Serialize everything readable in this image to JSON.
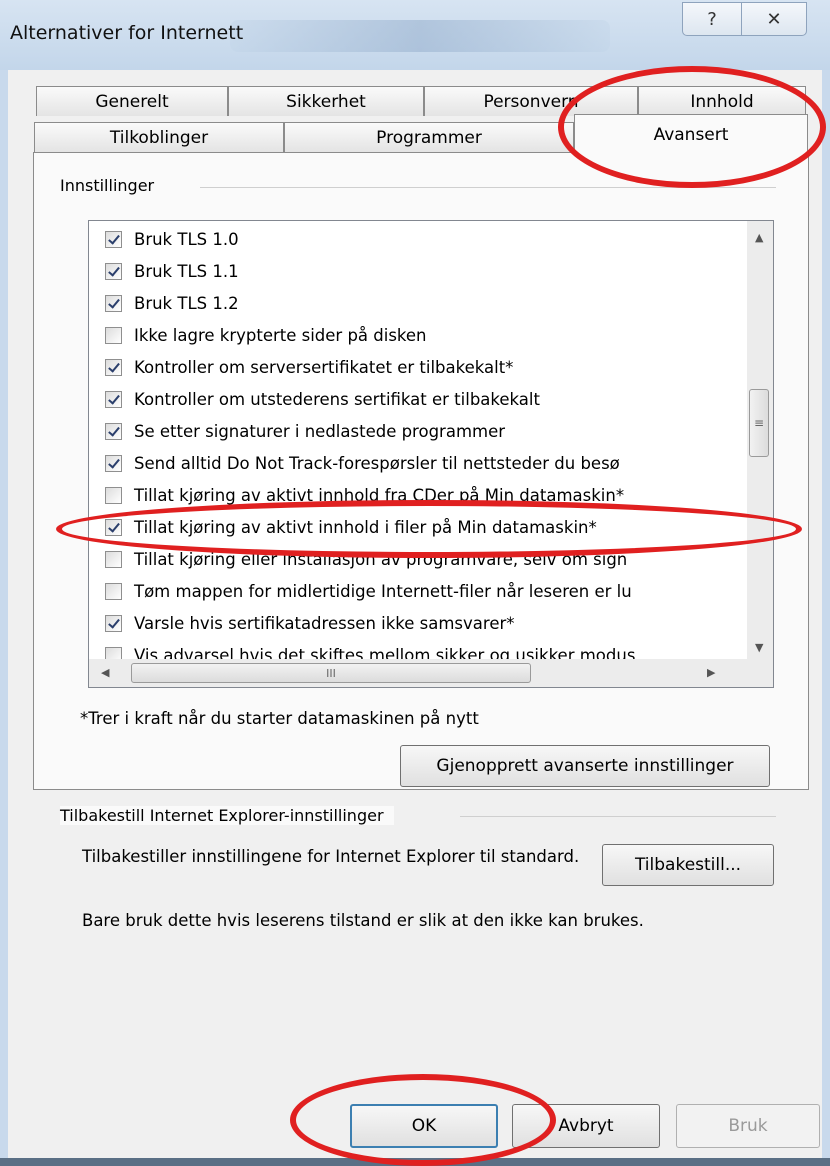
{
  "window": {
    "title": "Alternativer for Internett",
    "help_glyph": "?",
    "close_glyph": "✕"
  },
  "tabs": {
    "row1": [
      "Generelt",
      "Sikkerhet",
      "Personvern",
      "Innhold"
    ],
    "row2": [
      "Tilkoblinger",
      "Programmer",
      "Avansert"
    ],
    "active": "Avansert"
  },
  "settings": {
    "group_label": "Innstillinger",
    "items": [
      {
        "label": "Bruk TLS 1.0",
        "checked": true
      },
      {
        "label": "Bruk TLS 1.1",
        "checked": true
      },
      {
        "label": "Bruk TLS 1.2",
        "checked": true
      },
      {
        "label": "Ikke lagre krypterte sider på disken",
        "checked": false
      },
      {
        "label": "Kontroller om serversertifikatet er tilbakekalt*",
        "checked": true
      },
      {
        "label": "Kontroller om utstederens sertifikat er tilbakekalt",
        "checked": true
      },
      {
        "label": "Se etter signaturer i nedlastede programmer",
        "checked": true
      },
      {
        "label": "Send alltid Do Not Track-forespørsler til nettsteder du besø",
        "checked": true
      },
      {
        "label": "Tillat kjøring av aktivt innhold fra CDer på Min datamaskin*",
        "checked": false
      },
      {
        "label": "Tillat kjøring av aktivt innhold i filer på Min datamaskin*",
        "checked": true
      },
      {
        "label": "Tillat kjøring eller installasjon av programvare, selv om sign",
        "checked": false
      },
      {
        "label": "Tøm mappen for midlertidige Internett-filer når leseren er lu",
        "checked": false
      },
      {
        "label": "Varsle hvis sertifikatadressen ikke samsvarer*",
        "checked": true
      },
      {
        "label": "Vis advarsel hvis det skiftes mellom sikker og usikker modus",
        "checked": false
      }
    ],
    "restart_note": "*Trer i kraft når du starter datamaskinen på nytt",
    "restore_button": "Gjenopprett avanserte innstillinger",
    "scroll_grip": "≡",
    "hscroll_grip": "III"
  },
  "reset": {
    "group_label": "Tilbakestill Internet Explorer-innstillinger",
    "description": "Tilbakestiller innstillingene for Internet Explorer til standard.",
    "reset_button": "Tilbakestill...",
    "warning": "Bare bruk dette hvis leserens tilstand er slik at den ikke kan brukes."
  },
  "footer": {
    "ok": "OK",
    "cancel": "Avbryt",
    "apply": "Bruk"
  },
  "colors": {
    "annotation": "#e02020",
    "panel": "#fafafa",
    "dialog": "#f0f0f0"
  }
}
